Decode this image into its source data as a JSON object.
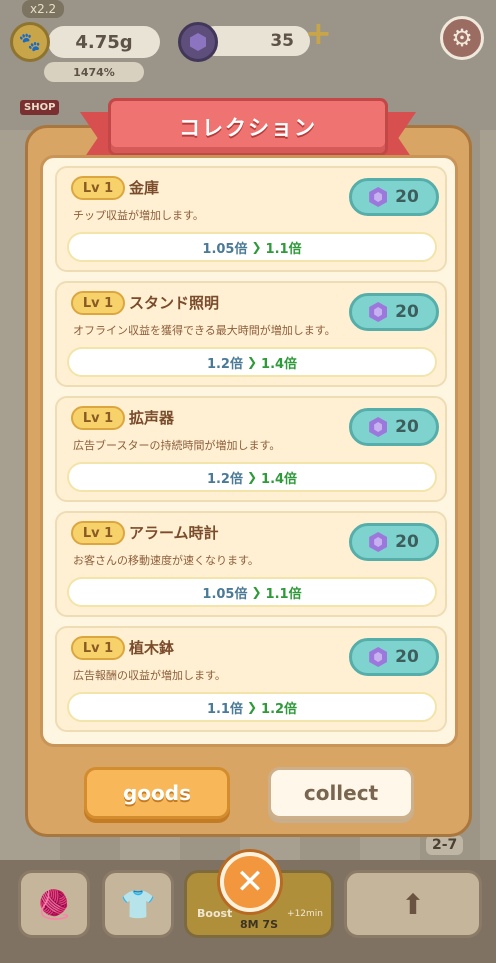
{
  "hud": {
    "multiplier": "x2.2",
    "gold": "4.75g",
    "gems": "35",
    "percent": "1474%",
    "shop_tag": "SHOP",
    "level": "2-7"
  },
  "bottom_bar": {
    "boost_label": "Boost",
    "boost_extra": "+12min",
    "timer": "8M 7S"
  },
  "modal": {
    "title": "コレクション",
    "tabs": {
      "goods": "goods",
      "collect": "collect"
    },
    "close_label": "✕"
  },
  "items": [
    {
      "level": "Lv 1",
      "name": "金庫",
      "description": "チップ収益が増加します。",
      "price": "20",
      "from": "1.05倍",
      "to": "1.1倍"
    },
    {
      "level": "Lv 1",
      "name": "スタンド照明",
      "description": "オフライン収益を獲得できる最大時間が増加します。",
      "price": "20",
      "from": "1.2倍",
      "to": "1.4倍"
    },
    {
      "level": "Lv 1",
      "name": "拡声器",
      "description": "広告ブースターの持続時間が増加します。",
      "price": "20",
      "from": "1.2倍",
      "to": "1.4倍"
    },
    {
      "level": "Lv 1",
      "name": "アラーム時計",
      "description": "お客さんの移動速度が速くなります。",
      "price": "20",
      "from": "1.05倍",
      "to": "1.1倍"
    },
    {
      "level": "Lv 1",
      "name": "植木鉢",
      "description": "広告報酬の収益が増加します。",
      "price": "20",
      "from": "1.1倍",
      "to": "1.2倍"
    }
  ],
  "icons": {
    "gem": "purple-gem-icon",
    "arrow": "chevron-right-icon"
  }
}
